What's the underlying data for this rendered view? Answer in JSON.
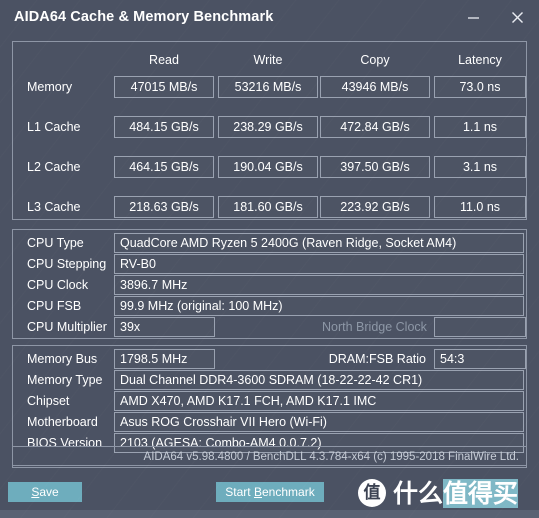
{
  "window": {
    "title": "AIDA64 Cache & Memory Benchmark",
    "minimize_label": "minimize",
    "close_label": "close"
  },
  "benchmark": {
    "columns": [
      "Read",
      "Write",
      "Copy",
      "Latency"
    ],
    "rows": [
      {
        "label": "Memory",
        "read": "47015 MB/s",
        "write": "53216 MB/s",
        "copy": "43946 MB/s",
        "latency": "73.0 ns"
      },
      {
        "label": "L1 Cache",
        "read": "484.15 GB/s",
        "write": "238.29 GB/s",
        "copy": "472.84 GB/s",
        "latency": "1.1 ns"
      },
      {
        "label": "L2 Cache",
        "read": "464.15 GB/s",
        "write": "190.04 GB/s",
        "copy": "397.50 GB/s",
        "latency": "3.1 ns"
      },
      {
        "label": "L3 Cache",
        "read": "218.63 GB/s",
        "write": "181.60 GB/s",
        "copy": "223.92 GB/s",
        "latency": "11.0 ns"
      }
    ]
  },
  "cpu_info": {
    "type_label": "CPU Type",
    "type_value": "QuadCore AMD Ryzen 5 2400G  (Raven Ridge, Socket AM4)",
    "stepping_label": "CPU Stepping",
    "stepping_value": "RV-B0",
    "clock_label": "CPU Clock",
    "clock_value": "3896.7 MHz",
    "fsb_label": "CPU FSB",
    "fsb_value": "99.9 MHz  (original: 100 MHz)",
    "multiplier_label": "CPU Multiplier",
    "multiplier_value": "39x",
    "north_bridge_label": "North Bridge Clock",
    "north_bridge_value": ""
  },
  "memory_info": {
    "bus_label": "Memory Bus",
    "bus_value": "1798.5 MHz",
    "ratio_label": "DRAM:FSB Ratio",
    "ratio_value": "54:3",
    "type_label": "Memory Type",
    "type_value": "Dual Channel DDR4-3600 SDRAM  (18-22-22-42 CR1)",
    "chipset_label": "Chipset",
    "chipset_value": "AMD X470, AMD K17.1 FCH, AMD K17.1 IMC",
    "motherboard_label": "Motherboard",
    "motherboard_value": "Asus ROG Crosshair VII Hero (Wi-Fi)",
    "bios_label": "BIOS Version",
    "bios_value": "2103  (AGESA: Combo-AM4 0.0.7.2)"
  },
  "footer": {
    "credits": "AIDA64 v5.98.4800 / BenchDLL 4.3.784-x64  (c) 1995-2018 FinalWire Ltd."
  },
  "actions": {
    "save_accel": "S",
    "save_rest": "ave",
    "start_pre": "Start ",
    "start_accel": "B",
    "start_rest": "enchmark"
  },
  "watermark": {
    "logo_glyph": "值",
    "text_plain": "什么",
    "text_highlight": "值得买"
  },
  "colors": {
    "background": "#4b5263",
    "accent": "#6eadbd",
    "border": "#8e96a6",
    "dim_text": "#8d97a6"
  }
}
